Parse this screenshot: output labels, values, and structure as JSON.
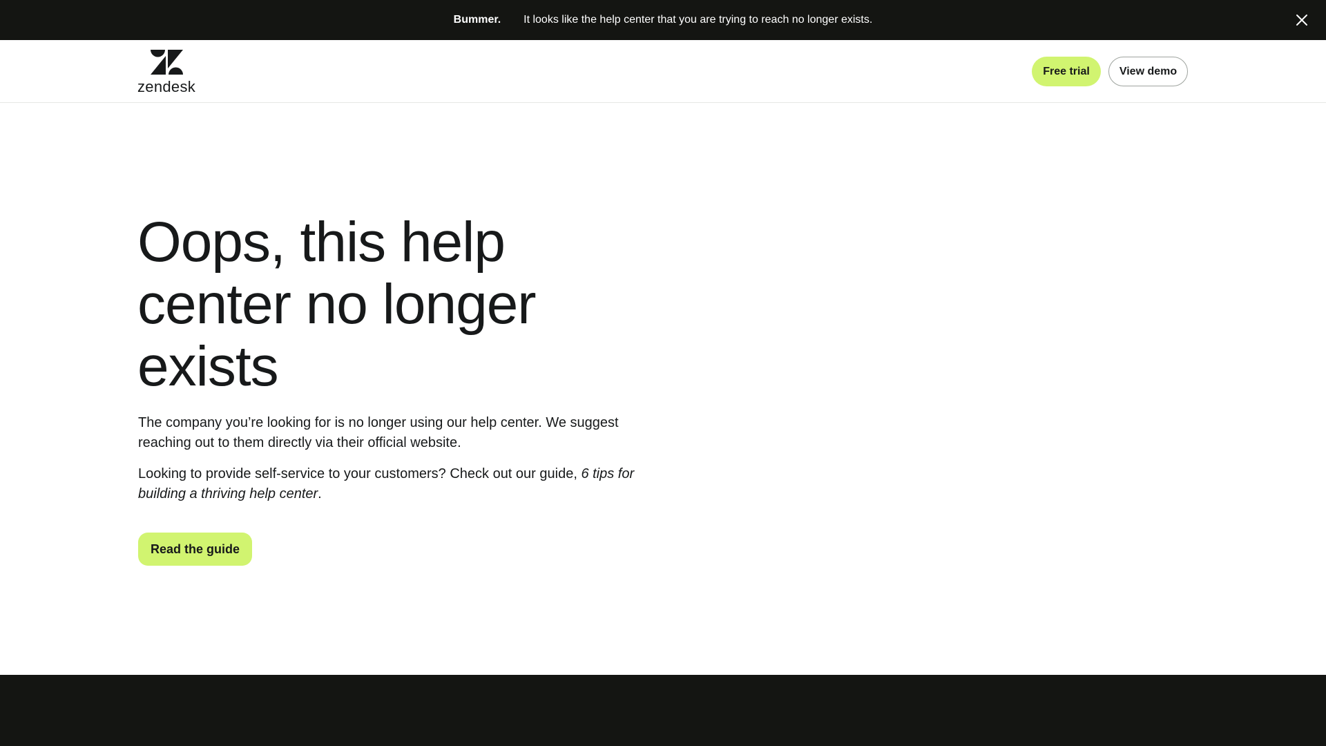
{
  "banner": {
    "strong": "Bummer.",
    "message": "It looks like the help center that you are trying to reach no longer exists."
  },
  "header": {
    "logo_text": "zendesk",
    "free_trial_label": "Free trial",
    "view_demo_label": "View demo"
  },
  "hero": {
    "title_lines": [
      "Oops, this help",
      "center no longer",
      "exists"
    ],
    "paragraph1": "The company you’re looking for is no longer using our help center. We suggest reaching out to them directly via their official website.",
    "paragraph2_lead": "Looking to provide self-service to your customers? Check out our guide, ",
    "paragraph2_guide_title": "6 tips for building a thriving help center",
    "paragraph2_end": ".",
    "cta_label": "Read the guide"
  },
  "icons": {
    "close": "close-icon",
    "logo": "zendesk-logo-icon"
  },
  "colors": {
    "dark": "#141512",
    "accent": "#d1f470",
    "text": "#17191a"
  }
}
